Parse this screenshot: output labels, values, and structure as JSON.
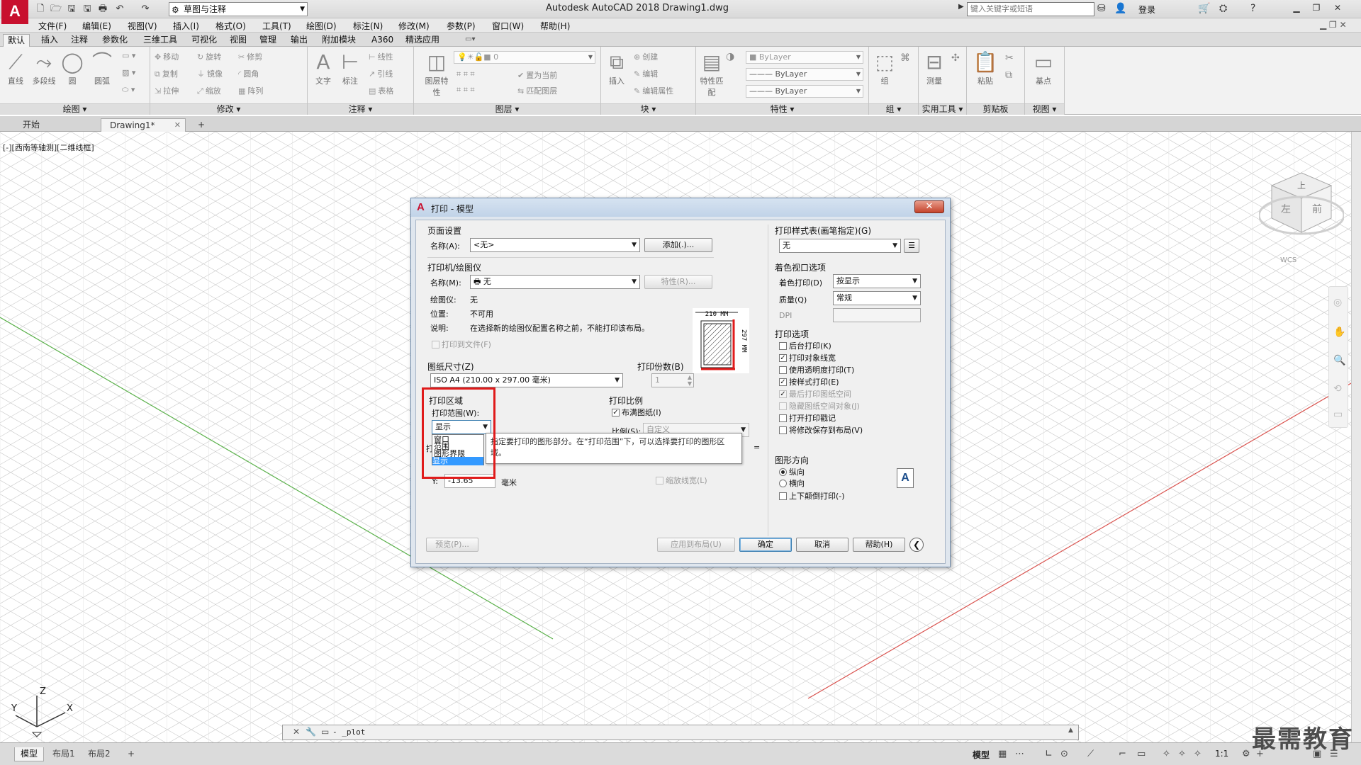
{
  "app": {
    "logo": "A",
    "title": "Autodesk AutoCAD 2018    Drawing1.dwg",
    "workspace": "草图与注释",
    "search_placeholder": "键入关键字或短语",
    "login": "登录"
  },
  "menubar": [
    "文件(F)",
    "编辑(E)",
    "视图(V)",
    "插入(I)",
    "格式(O)",
    "工具(T)",
    "绘图(D)",
    "标注(N)",
    "修改(M)",
    "参数(P)",
    "窗口(W)",
    "帮助(H)"
  ],
  "ribbon": {
    "tabs": [
      "默认",
      "插入",
      "注释",
      "参数化",
      "三维工具",
      "可视化",
      "视图",
      "管理",
      "输出",
      "附加模块",
      "A360",
      "精选应用"
    ],
    "active_tab": "默认",
    "panels": {
      "draw": {
        "title": "绘图 ▾",
        "big": [
          "直线",
          "多段线",
          "圆",
          "圆弧"
        ]
      },
      "modify": {
        "title": "修改 ▾",
        "small": [
          "移动",
          "旋转",
          "修剪",
          "复制",
          "镜像",
          "圆角",
          "拉伸",
          "缩放",
          "阵列"
        ]
      },
      "annotation": {
        "title": "注释 ▾",
        "big": [
          "文字",
          "标注"
        ],
        "small": [
          "线性",
          "引线",
          "表格"
        ]
      },
      "layers": {
        "title": "图层 ▾",
        "big": "图层特性",
        "combo": "0",
        "small": [
          "置为当前",
          "匹配图层"
        ]
      },
      "block": {
        "title": "块 ▾",
        "big": "插入",
        "small": [
          "创建",
          "编辑",
          "编辑属性"
        ]
      },
      "properties": {
        "title": "特性 ▾",
        "big": "特性匹配",
        "combos": [
          "ByLayer",
          "ByLayer",
          "ByLayer"
        ]
      },
      "groups": {
        "title": "组 ▾",
        "big": "组"
      },
      "utilities": {
        "title": "实用工具 ▾",
        "big": "测量"
      },
      "clipboard": {
        "title": "剪贴板",
        "big": "粘贴"
      },
      "view": {
        "title": "视图 ▾",
        "big": "基点"
      }
    }
  },
  "file_tabs": [
    "开始",
    "Drawing1*"
  ],
  "viewport_label": "[-][西南等轴测][二维线框]",
  "viewcube": {
    "top": "上",
    "left": "左",
    "front": "前",
    "wcs": "WCS"
  },
  "ucs": {
    "x": "X",
    "y": "Y",
    "z": "Z"
  },
  "command_line": "- _plot",
  "layout_tabs": [
    "模型",
    "布局1",
    "布局2"
  ],
  "status": {
    "model": "模型",
    "scale": "1:1"
  },
  "watermark": "最需教育",
  "dialog": {
    "logo": "A",
    "title": "打印 - 模型",
    "page_setup": {
      "group": "页面设置",
      "name_label": "名称(A):",
      "name_value": "<无>",
      "add_button": "添加(.)..."
    },
    "printer": {
      "group": "打印机/绘图仪",
      "name_label": "名称(M):",
      "name_value": "无",
      "properties_button": "特性(R)...",
      "plotter_label": "绘图仪:",
      "plotter_value": "无",
      "location_label": "位置:",
      "location_value": "不可用",
      "desc_label": "说明:",
      "desc_value": "在选择新的绘图仪配置名称之前，不能打印该布局。",
      "print_to_file": "打印到文件(F)",
      "paper_width": "210 MM",
      "paper_height": "297 MM"
    },
    "paper_size": {
      "group": "图纸尺寸(Z)",
      "value": "ISO A4 (210.00 x 297.00 毫米)"
    },
    "copies": {
      "group": "打印份数(B)",
      "value": "1"
    },
    "plot_area": {
      "group": "打印区域",
      "range_label": "打印范围(W):",
      "range_value": "显示",
      "options": [
        "窗口",
        "范围",
        "图形界限",
        "显示"
      ],
      "selected_option": "显示",
      "offset_label": "打",
      "y_label": "Y:",
      "y_value": "-13.65",
      "unit": "毫米"
    },
    "tooltip": "指定要打印的图形部分。在“打印范围”下，可以选择要打印的图形区域。",
    "plot_scale": {
      "group": "打印比例",
      "fit_paper": "布满图纸(I)",
      "scale_label": "比例(S):",
      "scale_value": "自定义",
      "equals": "=",
      "scale_lineweights": "缩放线宽(L)"
    },
    "plot_style_table": {
      "group": "打印样式表(画笔指定)(G)",
      "value": "无"
    },
    "shaded_viewport": {
      "group": "着色视口选项",
      "shade_label": "着色打印(D)",
      "shade_value": "按显示",
      "quality_label": "质量(Q)",
      "quality_value": "常规",
      "dpi_label": "DPI"
    },
    "plot_options": {
      "group": "打印选项",
      "items": [
        {
          "label": "后台打印(K)",
          "checked": false,
          "enabled": true
        },
        {
          "label": "打印对象线宽",
          "checked": true,
          "enabled": true
        },
        {
          "label": "使用透明度打印(T)",
          "checked": false,
          "enabled": true
        },
        {
          "label": "按样式打印(E)",
          "checked": true,
          "enabled": true
        },
        {
          "label": "最后打印图纸空间",
          "checked": true,
          "enabled": false
        },
        {
          "label": "隐藏图纸空间对象(J)",
          "checked": false,
          "enabled": false
        },
        {
          "label": "打开打印戳记",
          "checked": false,
          "enabled": true
        },
        {
          "label": "将修改保存到布局(V)",
          "checked": false,
          "enabled": true
        }
      ]
    },
    "orientation": {
      "group": "图形方向",
      "portrait": "纵向",
      "landscape": "横向",
      "upside_down": "上下颠倒打印(-)",
      "selected": "portrait",
      "icon": "A"
    },
    "buttons": {
      "preview": "预览(P)...",
      "apply": "应用到布局(U)",
      "ok": "确定",
      "cancel": "取消",
      "help": "帮助(H)",
      "expand": "❮"
    }
  },
  "colors": {
    "accent": "#c8102e",
    "highlight_box": "#e01b1b",
    "selection": "#3399ff",
    "grid": "#c9c9c9"
  }
}
